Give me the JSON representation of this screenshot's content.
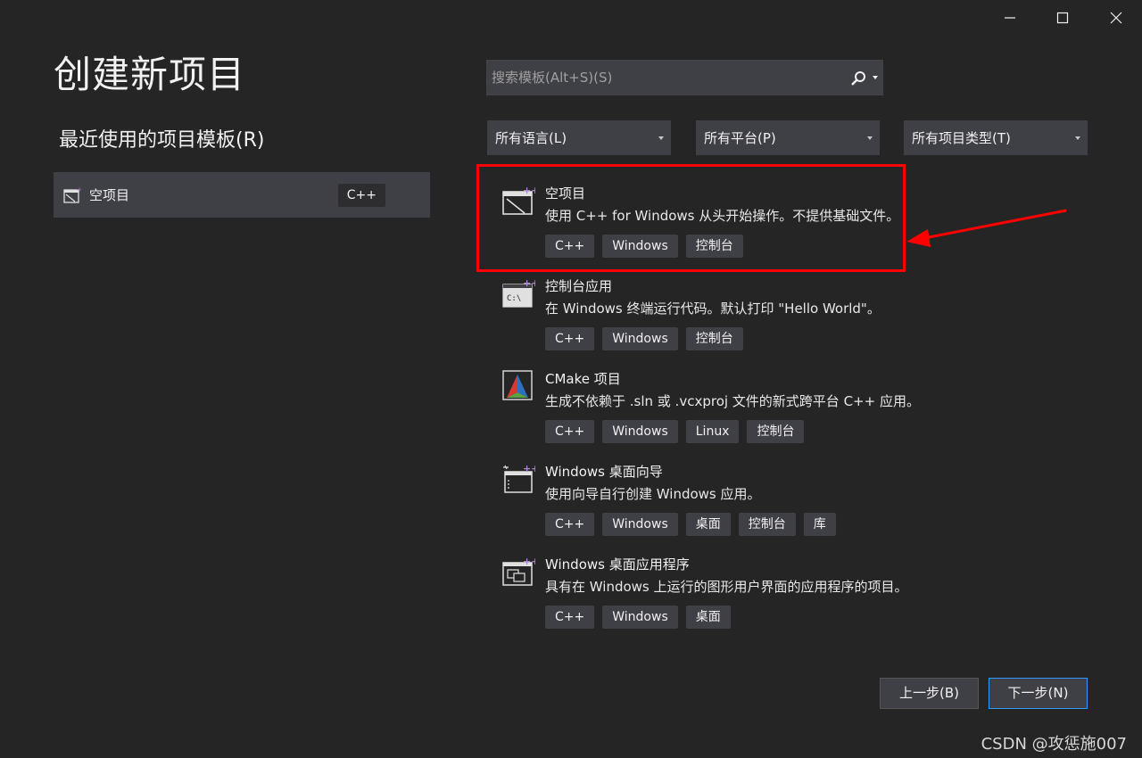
{
  "header": {
    "title": "创建新项目",
    "recent_heading": "最近使用的项目模板(R)"
  },
  "recent": {
    "items": [
      {
        "name": "空项目",
        "tag": "C++"
      }
    ]
  },
  "search": {
    "placeholder": "搜索模板(Alt+S)(S)"
  },
  "filters": {
    "language": "所有语言(L)",
    "platform": "所有平台(P)",
    "project_type": "所有项目类型(T)"
  },
  "templates": [
    {
      "name": "空项目",
      "description": "使用 C++ for Windows 从头开始操作。不提供基础文件。",
      "tags": [
        "C++",
        "Windows",
        "控制台"
      ],
      "icon": "empty-project-icon"
    },
    {
      "name": "控制台应用",
      "description": "在 Windows 终端运行代码。默认打印 \"Hello World\"。",
      "tags": [
        "C++",
        "Windows",
        "控制台"
      ],
      "icon": "console-app-icon"
    },
    {
      "name": "CMake 项目",
      "description": "生成不依赖于 .sln 或 .vcxproj 文件的新式跨平台 C++ 应用。",
      "tags": [
        "C++",
        "Windows",
        "Linux",
        "控制台"
      ],
      "icon": "cmake-icon"
    },
    {
      "name": "Windows 桌面向导",
      "description": "使用向导自行创建 Windows 应用。",
      "tags": [
        "C++",
        "Windows",
        "桌面",
        "控制台",
        "库"
      ],
      "icon": "desktop-wizard-icon"
    },
    {
      "name": "Windows 桌面应用程序",
      "description": "具有在 Windows 上运行的图形用户界面的应用程序的项目。",
      "tags": [
        "C++",
        "Windows",
        "桌面"
      ],
      "icon": "desktop-app-icon"
    }
  ],
  "buttons": {
    "back": "上一步(B)",
    "next": "下一步(N)"
  },
  "watermark": "CSDN @攻惩施007",
  "colors": {
    "background": "#252526",
    "panel": "#3f3f46",
    "accent": "#3399ff",
    "highlight": "#ff0000",
    "new_badge": "#b180d7"
  }
}
